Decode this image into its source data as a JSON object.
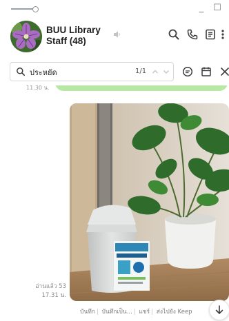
{
  "window": {
    "minimize": "_",
    "maximize": "☐"
  },
  "chat": {
    "group_name": "BUU Library Staff (48)"
  },
  "search": {
    "query": "ประหยัด",
    "match_count": "1/1"
  },
  "message": {
    "prev_meta": "11.30 น.",
    "read_status": "อ่านแล้ว 53",
    "time": "17.31 น.",
    "actions": [
      "บันทึก",
      "บันทึกเป็น...",
      "แชร์",
      "ส่งไปยัง Keep"
    ]
  },
  "colors": {
    "bubble_green": "#b8e8a6",
    "icon_gray": "#3c3c3c"
  }
}
